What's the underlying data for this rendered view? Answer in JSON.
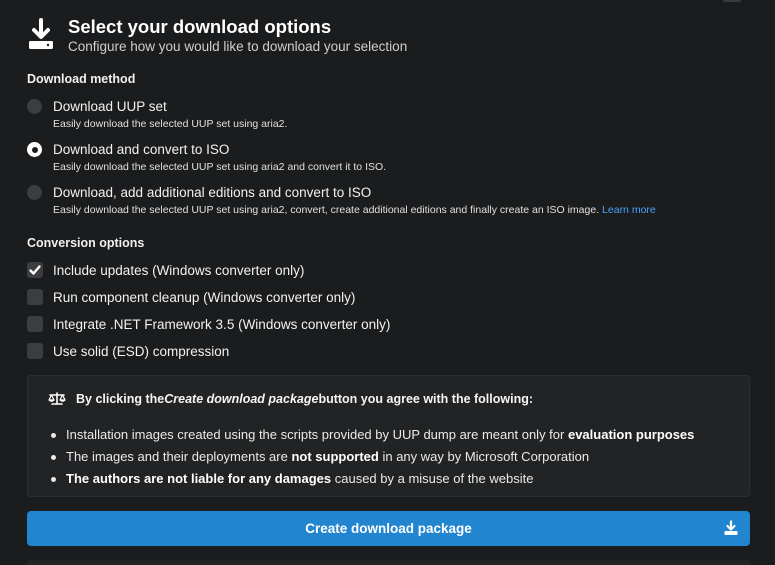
{
  "header": {
    "title": "Select your download options",
    "subtitle": "Configure how you would like to download your selection"
  },
  "download_method": {
    "label": "Download method",
    "options": [
      {
        "label": "Download UUP set",
        "desc": "Easily download the selected UUP set using aria2.",
        "checked": false
      },
      {
        "label": "Download and convert to ISO",
        "desc": "Easily download the selected UUP set using aria2 and convert it to ISO.",
        "checked": true
      },
      {
        "label": "Download, add additional editions and convert to ISO",
        "desc": "Easily download the selected UUP set using aria2, convert, create additional editions and finally create an ISO image.",
        "link": "Learn more",
        "checked": false
      }
    ]
  },
  "conversion_options": {
    "label": "Conversion options",
    "options": [
      {
        "label": "Include updates (Windows converter only)",
        "checked": true
      },
      {
        "label": "Run component cleanup (Windows converter only)",
        "checked": false
      },
      {
        "label": "Integrate .NET Framework 3.5 (Windows converter only)",
        "checked": false
      },
      {
        "label": "Use solid (ESD) compression",
        "checked": false
      }
    ]
  },
  "notice": {
    "head_prefix": "By clicking the ",
    "head_em": "Create download package",
    "head_suffix": " button you agree with the following:",
    "items": [
      {
        "pre": "Installation images created using the scripts provided by UUP dump are meant only for ",
        "bold": "evaluation purposes",
        "post": ""
      },
      {
        "pre": "The images and their deployments are ",
        "bold": "not supported",
        "post": " in any way by Microsoft Corporation"
      },
      {
        "pre": "",
        "bold": "The authors are not liable for any damages",
        "post": " caused by a misuse of the website"
      }
    ]
  },
  "button": {
    "label": "Create download package"
  },
  "colors": {
    "accent": "#2185d0",
    "link": "#4aa3ff",
    "background": "#1b1c1d"
  },
  "icons": {
    "header": "download-icon",
    "notice": "balance-scale-icon",
    "button": "download-icon"
  }
}
